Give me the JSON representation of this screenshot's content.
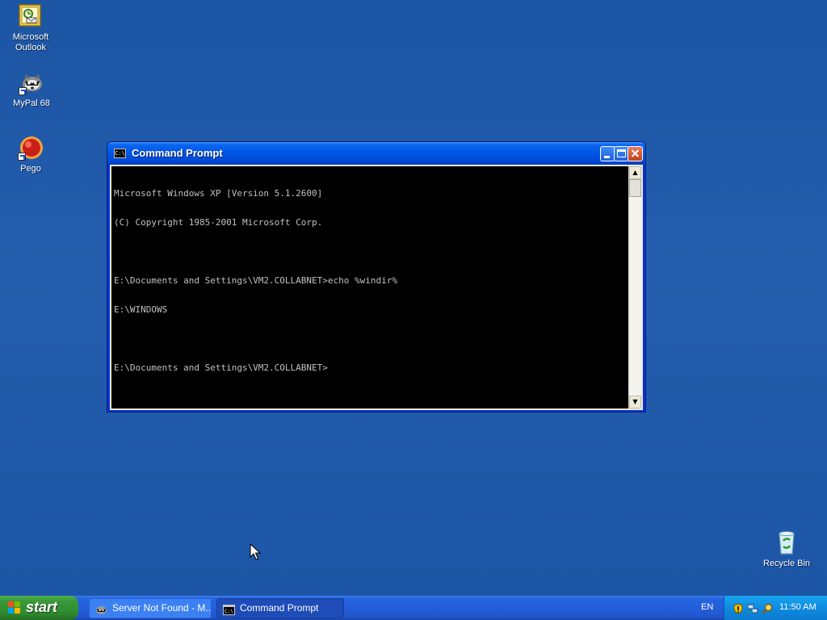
{
  "desktop": {
    "icons": [
      {
        "label_line1": "Microsoft",
        "label_line2": "Outlook",
        "icon": "outlook-icon"
      },
      {
        "label_line1": "MyPal 68",
        "label_line2": "",
        "icon": "mypal-raccoon-icon"
      },
      {
        "label_line1": "Pego",
        "label_line2": "",
        "icon": "pego-red-ball-icon"
      },
      {
        "label_line1": "Recycle Bin",
        "label_line2": "",
        "icon": "recycle-bin-icon"
      }
    ]
  },
  "window": {
    "title": "Command Prompt",
    "console_lines": [
      "Microsoft Windows XP [Version 5.1.2600]",
      "(C) Copyright 1985-2001 Microsoft Corp.",
      "",
      "E:\\Documents and Settings\\VM2.COLLABNET>echo %windir%",
      "E:\\WINDOWS",
      "",
      "E:\\Documents and Settings\\VM2.COLLABNET>"
    ]
  },
  "taskbar": {
    "start_label": "start",
    "tasks": [
      {
        "label": "Server Not Found - M...",
        "icon": "mypal-raccoon-icon"
      },
      {
        "label": "Command Prompt",
        "icon": "cmd-icon"
      }
    ],
    "language": "EN",
    "clock": "11:50 AM",
    "tray_icons": [
      "security-shield-icon",
      "network-icon",
      "search-icon"
    ]
  },
  "colors": {
    "desktop_bg": "#1f59a8",
    "titlebar": "#0054e3",
    "taskbar": "#245edb",
    "start_button": "#3a9a3a",
    "console_bg": "#000000",
    "console_text": "#c0c0c0"
  }
}
